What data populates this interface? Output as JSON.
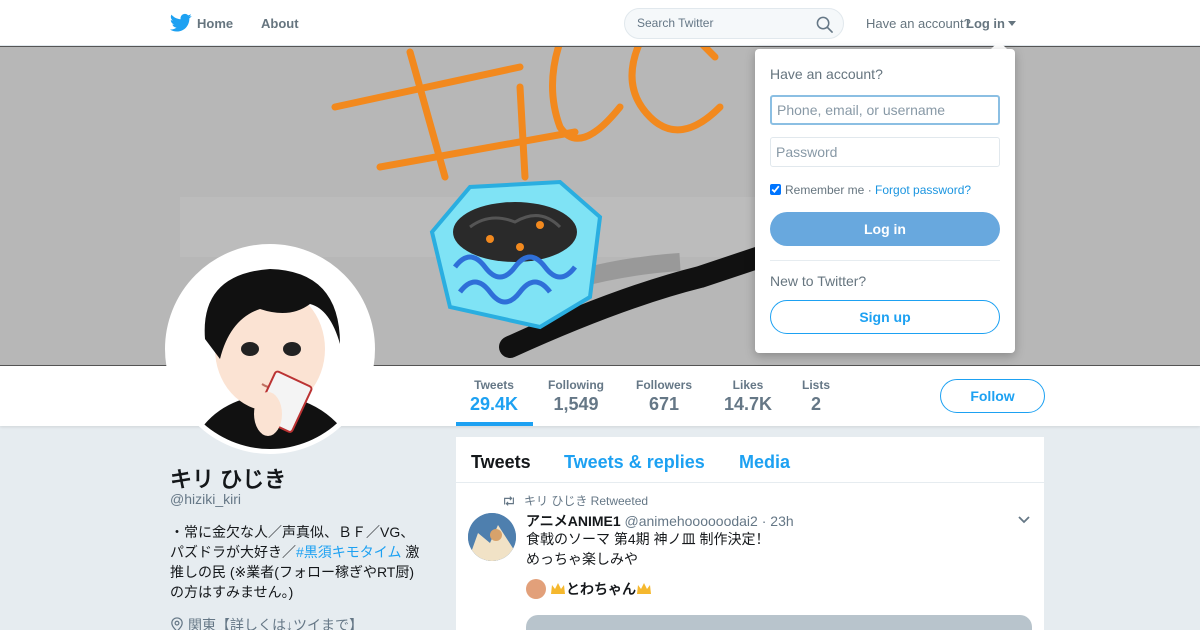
{
  "nav": {
    "home_label": "Home",
    "about_label": "About",
    "search_placeholder": "Search Twitter",
    "have_account_label": "Have an account?",
    "login_label": "Log in"
  },
  "profile": {
    "name": "キリ ひじき",
    "handle": "@hiziki_kiri",
    "bio_part1": "・常に金欠な人／声真似、ＢＦ／VG、パズドラが大好き／",
    "bio_hashtag": "#黒須キモタイム",
    "bio_part2": " 激推しの民 (※業者(フォロー稼ぎやRT厨)の方はすみません。)",
    "location": "関東【詳しくは↓ツイまで】",
    "follow_label": "Follow"
  },
  "stats": [
    {
      "label": "Tweets",
      "value": "29.4K"
    },
    {
      "label": "Following",
      "value": "1,549"
    },
    {
      "label": "Followers",
      "value": "671"
    },
    {
      "label": "Likes",
      "value": "14.7K"
    },
    {
      "label": "Lists",
      "value": "2"
    }
  ],
  "timeline": {
    "tabs": [
      {
        "label": "Tweets"
      },
      {
        "label": "Tweets & replies"
      },
      {
        "label": "Media"
      }
    ],
    "tweet": {
      "retweet_label": "キリ ひじき Retweeted",
      "author_name": "アニメANIME1",
      "author_handle": "@animehoooooodai2",
      "time": "· 23h",
      "text_line1": "食戟のソーマ 第4期 神ノ皿 制作決定！",
      "text_line2": "めっちゃ楽しみや",
      "quoted_user": "とわちゃん"
    }
  },
  "login_dropdown": {
    "title": "Have an account?",
    "username_placeholder": "Phone, email, or username",
    "password_placeholder": "Password",
    "remember_label": "Remember me",
    "separator": " · ",
    "forgot_label": "Forgot password?",
    "login_button": "Log in",
    "new_label": "New to Twitter?",
    "signup_button": "Sign up"
  },
  "colors": {
    "accent": "#1da1f2",
    "background": "#e6ecf0",
    "muted_text": "#657786",
    "login_button": "#68a8de"
  },
  "icons": [
    "twitter-bird-icon",
    "search-icon",
    "caret-down-icon",
    "retweet-icon",
    "location-pin-icon",
    "chevron-down-icon",
    "crown-icon"
  ]
}
